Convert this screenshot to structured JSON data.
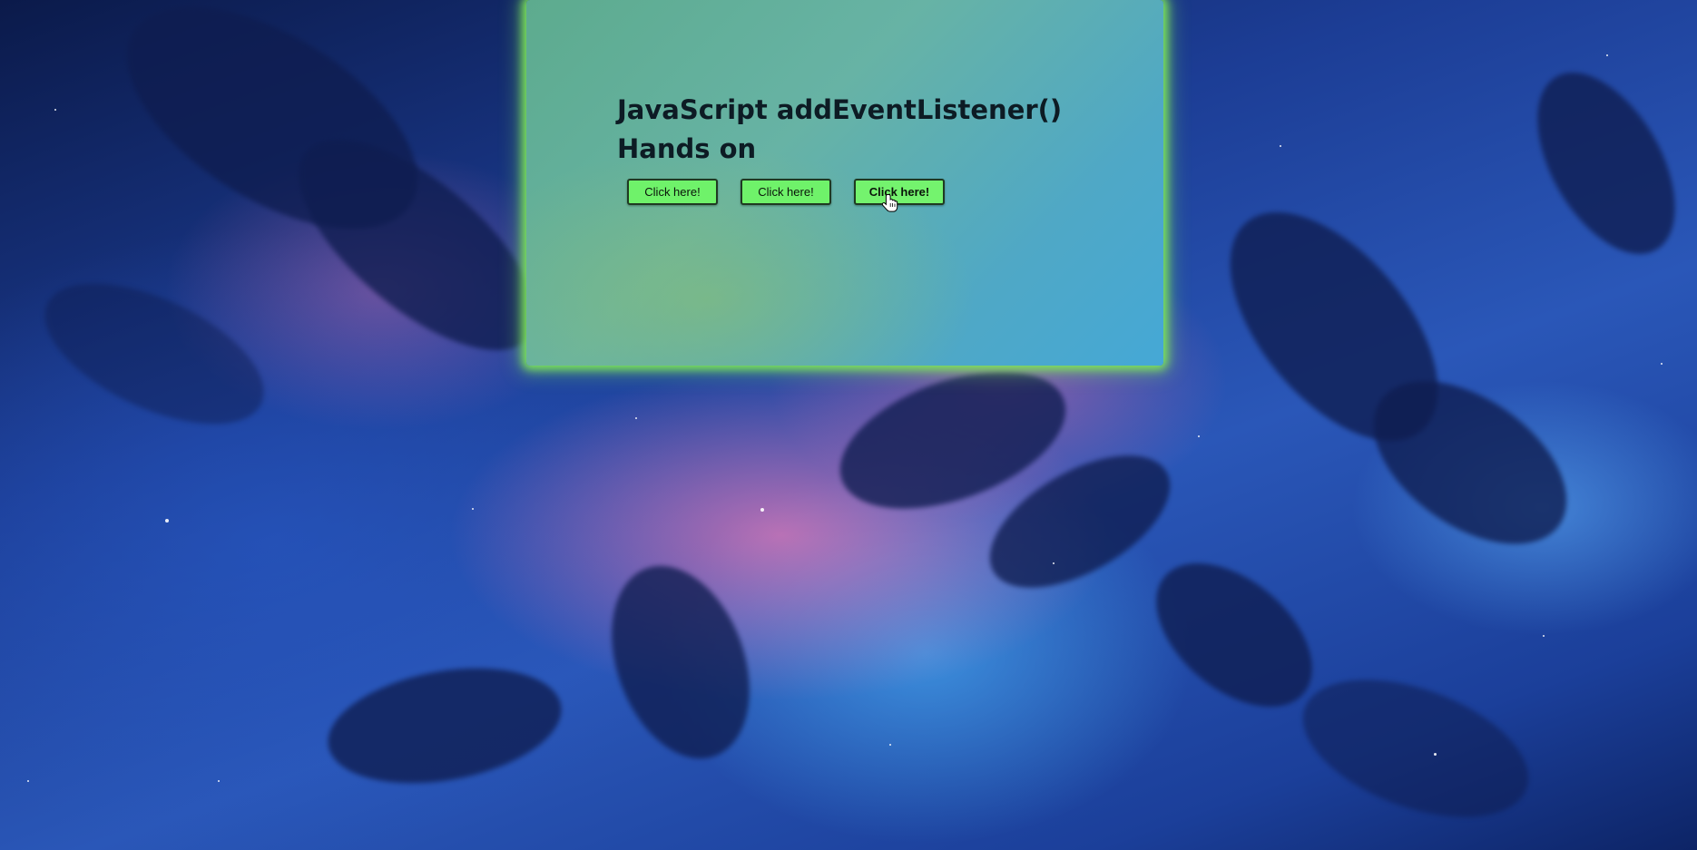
{
  "page": {
    "heading": "JavaScript addEventListener() Hands on"
  },
  "buttons": [
    {
      "label": "Click here!"
    },
    {
      "label": "Click here!"
    },
    {
      "label": "Click here!"
    }
  ],
  "colors": {
    "panel_glow": "#7ee85a",
    "button_bg": "#6ff26a",
    "heading_text": "#0d1b24"
  },
  "icons": {
    "cursor": "hand-pointer-icon"
  }
}
